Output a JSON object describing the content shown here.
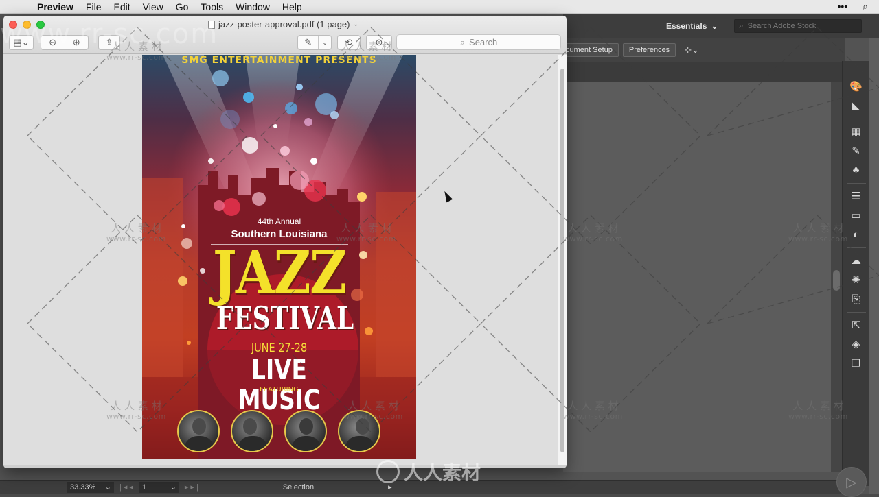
{
  "menubar": {
    "app_name": "Preview",
    "menus": [
      "File",
      "Edit",
      "View",
      "Go",
      "Tools",
      "Window",
      "Help"
    ],
    "right_icons": [
      "more-icon",
      "spotlight-icon"
    ]
  },
  "illustrator": {
    "workspace_label": "Essentials",
    "stock_search_placeholder": "Search Adobe Stock",
    "document_setup_label": "cument Setup",
    "preferences_label": "Preferences",
    "status": {
      "zoom": "33.33%",
      "page": "1",
      "mode": "Selection"
    }
  },
  "preview": {
    "title": "jazz-poster-approval.pdf (1 page)",
    "search_placeholder": "Search",
    "toolbar_icons": [
      "sidebar-icon",
      "zoom-out-icon",
      "zoom-in-icon",
      "share-icon",
      "markup-icon",
      "rotate-icon",
      "annotate-icon"
    ]
  },
  "poster": {
    "presents": "SMG ENTERTAINMENT PRESENTS",
    "annual": "44th Annual",
    "region": "Southern Louisiana",
    "jazz": "JAZZ",
    "festival": "FESTIVAL",
    "dates": "JUNE 27-28",
    "live_music": "LIVE MUSIC",
    "featuring": "FEATURING",
    "performer_count": 4
  },
  "watermark": {
    "cn": "人 人 素 材",
    "url": "www.rr-sc.com",
    "big": "www.rr-sc.com",
    "logo_text": "人人素材"
  }
}
